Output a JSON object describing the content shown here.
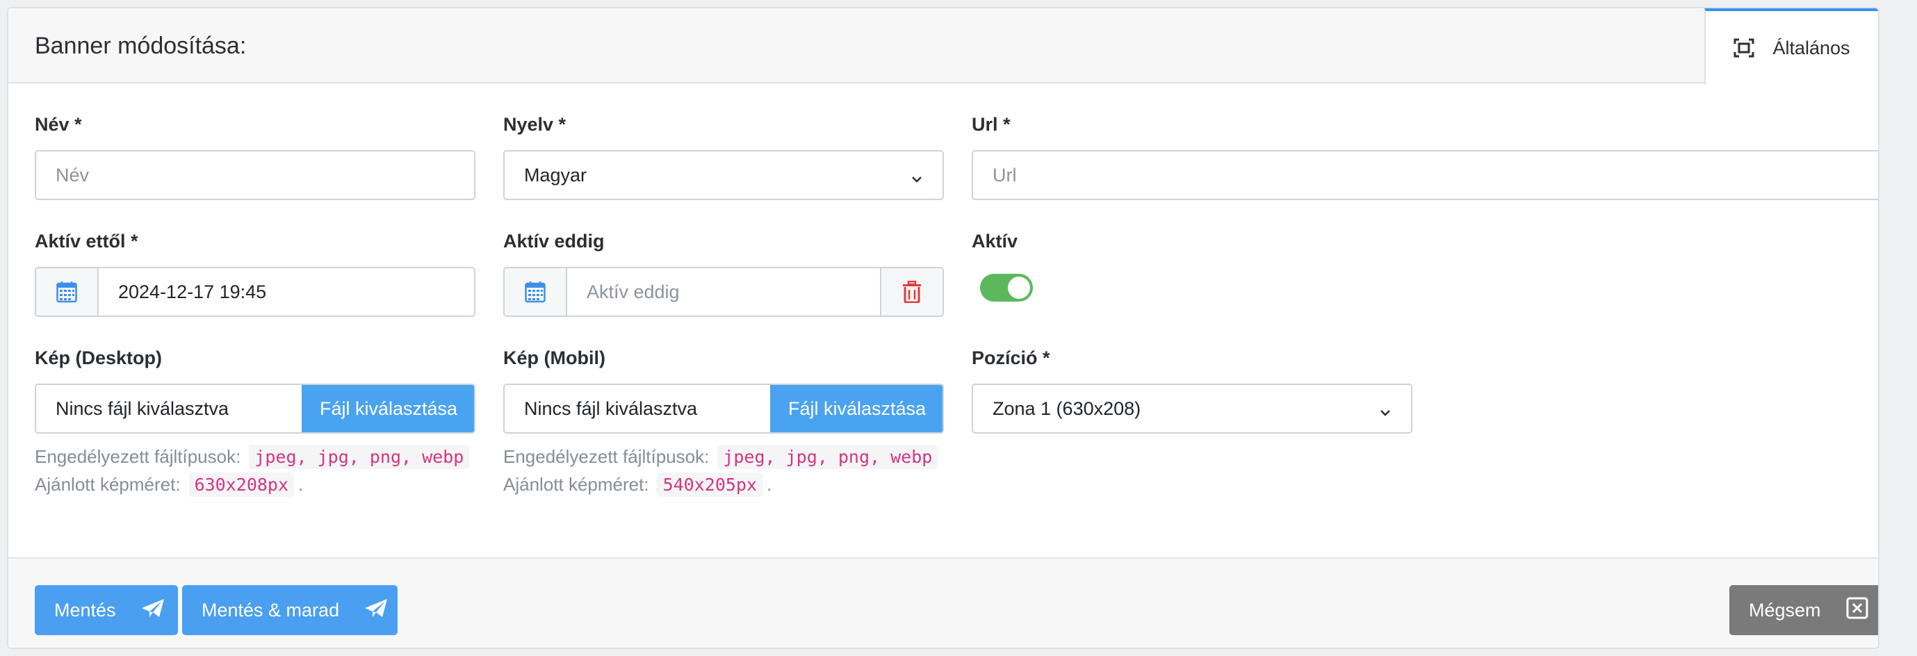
{
  "header": {
    "title": "Banner módosítása:",
    "tab_label": "Általános",
    "tab_icon": "maximize-icon"
  },
  "fields": {
    "name": {
      "label": "Név *",
      "placeholder": "Név",
      "value": ""
    },
    "language": {
      "label": "Nyelv *",
      "selected": "Magyar"
    },
    "url": {
      "label": "Url *",
      "placeholder": "Url",
      "value": ""
    },
    "active_from": {
      "label": "Aktív ettől *",
      "value": "2024-12-17 19:45"
    },
    "active_until": {
      "label": "Aktív eddig",
      "placeholder": "Aktív eddig"
    },
    "active": {
      "label": "Aktív",
      "checked": true
    },
    "image_desktop": {
      "label": "Kép (Desktop)",
      "file_status": "Nincs fájl kiválasztva",
      "button_label": "Fájl kiválasztása",
      "allowed_types_label": "Engedélyezett fájltípusok:",
      "allowed_types": "jpeg, jpg, png, webp",
      "recommended_size_label": "Ajánlott képméret:",
      "recommended_size": "630x208px",
      "suffix": "."
    },
    "image_mobile": {
      "label": "Kép (Mobil)",
      "file_status": "Nincs fájl kiválasztva",
      "button_label": "Fájl kiválasztása",
      "allowed_types_label": "Engedélyezett fájltípusok:",
      "allowed_types": "jpeg, jpg, png, webp",
      "recommended_size_label": "Ajánlott képméret:",
      "recommended_size": "540x205px",
      "suffix": "."
    },
    "position": {
      "label": "Pozíció *",
      "selected": "Zona 1 (630x208)"
    }
  },
  "footer": {
    "save_label": "Mentés",
    "save_stay_label": "Mentés & marad",
    "cancel_label": "Mégsem"
  },
  "colors": {
    "primary": "#4a9ff0",
    "toggle_on": "#5cb85c",
    "danger": "#e03c3c",
    "code_text": "#d63384",
    "secondary": "#7a7a7a"
  }
}
